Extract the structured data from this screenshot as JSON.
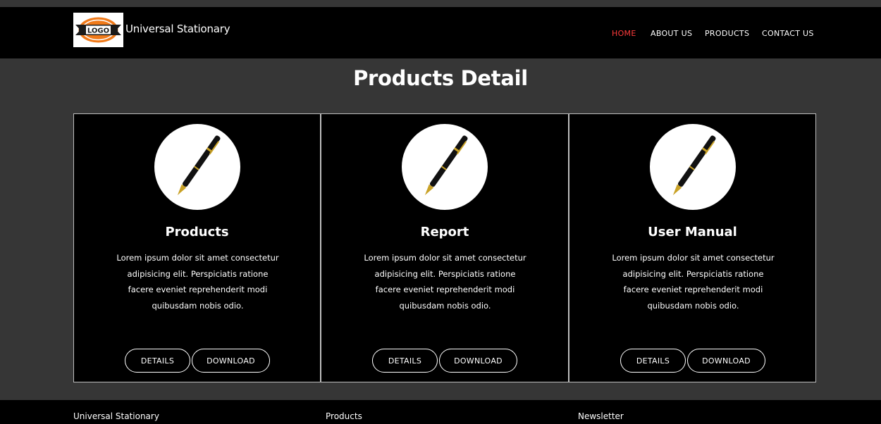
{
  "navbar": {
    "logo_text": "LOGO",
    "brand": "Universal Stationary",
    "links": [
      {
        "label": "HOME",
        "active": true
      },
      {
        "label": "ABOUT US",
        "active": false
      },
      {
        "label": "PRODUCTS",
        "active": false
      },
      {
        "label": "CONTACT US",
        "active": false
      }
    ]
  },
  "page": {
    "title": "Products Detail"
  },
  "cards": [
    {
      "title": "Products",
      "text": "Lorem ipsum dolor sit amet consectetur adipisicing elit. Perspiciatis ratione facere eveniet reprehenderit modi quibusdam nobis odio.",
      "details_label": "DETAILS",
      "download_label": "DOWNLOAD",
      "image_icon": "pen-icon"
    },
    {
      "title": "Report",
      "text": "Lorem ipsum dolor sit amet consectetur adipisicing elit. Perspiciatis ratione facere eveniet reprehenderit modi quibusdam nobis odio.",
      "details_label": "DETAILS",
      "download_label": "DOWNLOAD",
      "image_icon": "pen-icon"
    },
    {
      "title": "User Manual",
      "text": "Lorem ipsum dolor sit amet consectetur adipisicing elit. Perspiciatis ratione facere eveniet reprehenderit modi quibusdam nobis odio.",
      "details_label": "DETAILS",
      "download_label": "DOWNLOAD",
      "image_icon": "pen-icon"
    }
  ],
  "footer": {
    "col1": "Universal Stationary",
    "col2": "Products",
    "col3": "Newsletter"
  },
  "colors": {
    "background": "#363636",
    "navbar": "#000000",
    "active_link": "#ff3b3b",
    "logo_orange": "#f07a1a"
  }
}
